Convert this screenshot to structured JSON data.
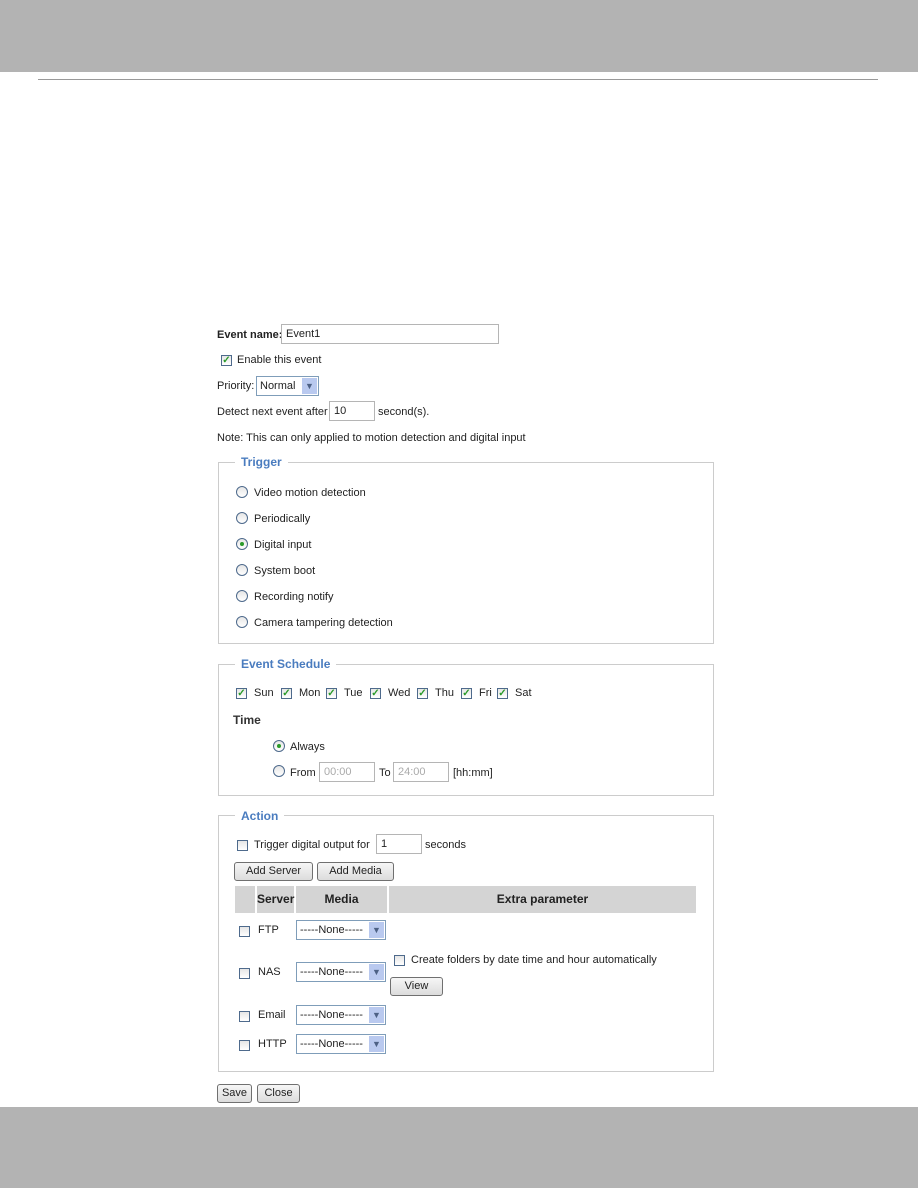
{
  "form": {
    "event_name_label": "Event name:",
    "event_name_value": "Event1",
    "enable_label": "Enable this event",
    "enable_checked": true,
    "priority_label": "Priority:",
    "priority_value": "Normal",
    "detect_label": "Detect next event after",
    "detect_value": "10",
    "detect_unit": "second(s).",
    "note": "Note: This can only applied to motion detection and digital input"
  },
  "trigger": {
    "legend": "Trigger",
    "options": [
      "Video motion detection",
      "Periodically",
      "Digital input",
      "System boot",
      "Recording notify",
      "Camera tampering detection"
    ],
    "selected": "Digital input"
  },
  "schedule": {
    "legend": "Event Schedule",
    "days": [
      "Sun",
      "Mon",
      "Tue",
      "Wed",
      "Thu",
      "Fri",
      "Sat"
    ],
    "time_label": "Time",
    "always_label": "Always",
    "from_label": "From",
    "from_value": "00:00",
    "to_label": "To",
    "to_value": "24:00",
    "format": "[hh:mm]",
    "selected": "Always"
  },
  "action": {
    "legend": "Action",
    "trigger_output_label": "Trigger digital output for",
    "trigger_output_value": "1",
    "trigger_output_unit": "seconds",
    "add_server": "Add Server",
    "add_media": "Add Media",
    "columns": [
      "Server",
      "Media",
      "Extra parameter"
    ],
    "rows": [
      {
        "server": "FTP",
        "media": "-----None-----"
      },
      {
        "server": "NAS",
        "media": "-----None-----"
      },
      {
        "server": "Email",
        "media": "-----None-----"
      },
      {
        "server": "HTTP",
        "media": "-----None-----"
      }
    ],
    "nas_folders_label": "Create folders by date time and hour automatically",
    "view": "View"
  },
  "buttons": {
    "save": "Save",
    "close": "Close"
  },
  "colors": {
    "legend": "#4a7cbf",
    "header_bar": "#b3b3b3",
    "check": "#2a9a2a"
  }
}
